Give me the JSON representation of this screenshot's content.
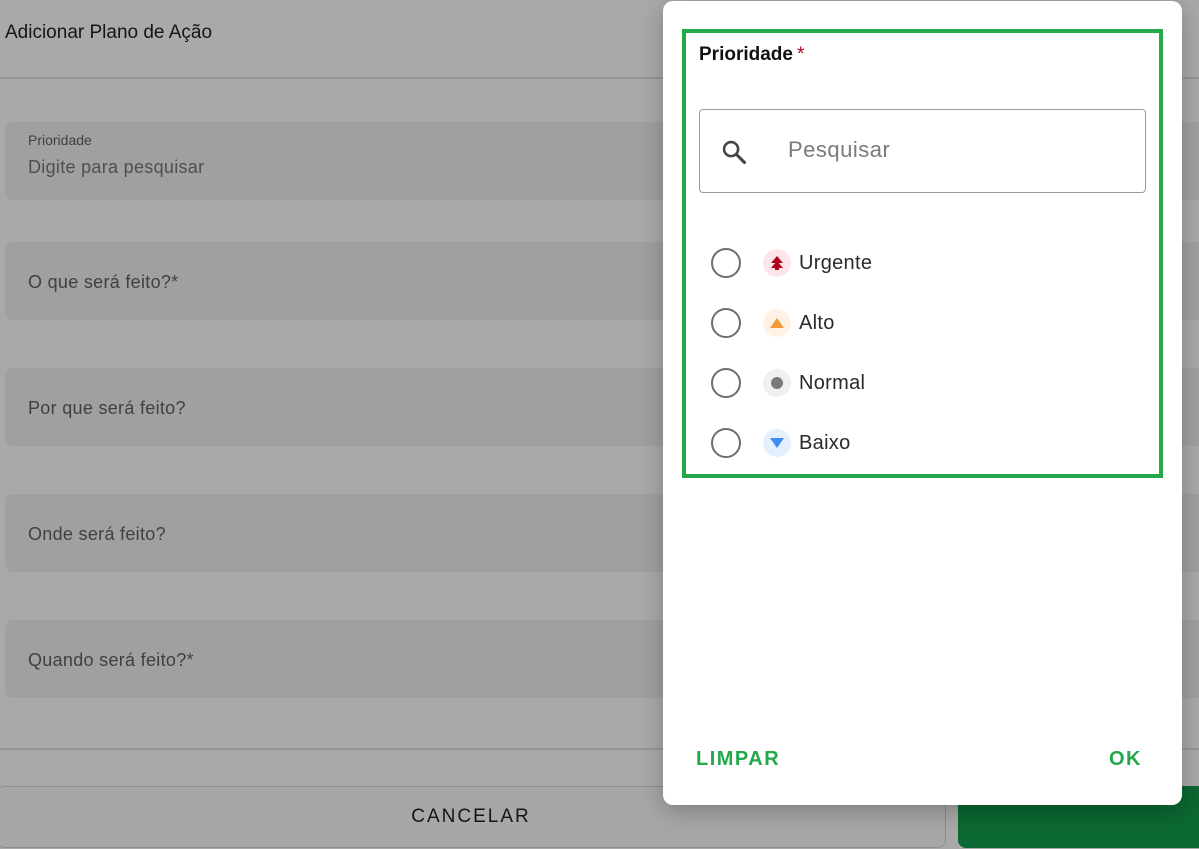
{
  "page": {
    "title": "Adicionar Plano de Ação",
    "fields": [
      {
        "label": "Prioridade",
        "placeholder": "Digite para pesquisar"
      },
      {
        "label": "O que será feito?*"
      },
      {
        "label": "Por que será feito?"
      },
      {
        "label": "Onde será feito?"
      },
      {
        "label": "Quando será feito?*"
      }
    ],
    "cancel_label": "CANCELAR"
  },
  "dialog": {
    "title": "Prioridade",
    "required_mark": "*",
    "search_placeholder": "Pesquisar",
    "options": [
      {
        "label": "Urgente",
        "icon": "double-chevron-up-icon",
        "color": "#b00020",
        "bg": "#fde6ea"
      },
      {
        "label": "Alto",
        "icon": "triangle-up-icon",
        "color": "#f39a3a",
        "bg": "#fff1e3"
      },
      {
        "label": "Normal",
        "icon": "dot-icon",
        "color": "#7a7a7a",
        "bg": "#f0f0f0"
      },
      {
        "label": "Baixo",
        "icon": "triangle-down-icon",
        "color": "#3d8df5",
        "bg": "#e5f0ff"
      }
    ],
    "clear_label": "LIMPAR",
    "ok_label": "OK"
  },
  "colors": {
    "accent": "#23a84a",
    "save_button": "#129a4b",
    "required": "#b00020"
  }
}
